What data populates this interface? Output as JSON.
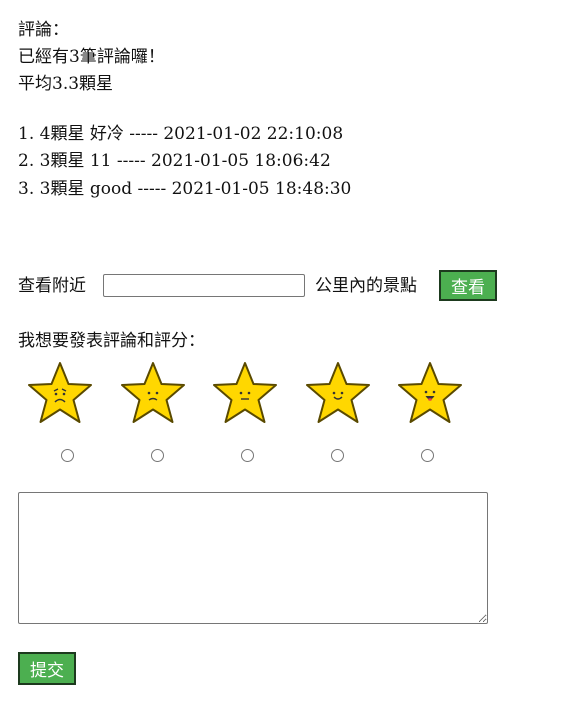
{
  "summary": {
    "heading": "評論：",
    "count_text": "已經有3筆評論囉！",
    "average_text": "平均3.3顆星"
  },
  "reviews": [
    {
      "text": "1. 4顆星 好冷 ----- 2021-01-02 22:10:08"
    },
    {
      "text": "2. 3顆星 11 ----- 2021-01-05 18:06:42"
    },
    {
      "text": "3. 3顆星 good ----- 2021-01-05 18:48:30"
    }
  ],
  "nearby": {
    "prefix": "查看附近",
    "input_value": "",
    "suffix": "公里內的景點",
    "button_label": "查看"
  },
  "rating": {
    "prompt": "我想要發表評論和評分：",
    "star_fill": "#ffd700",
    "star_stroke": "#5a4a00",
    "options": [
      {
        "icon": "sad-star-icon"
      },
      {
        "icon": "frown-star-icon"
      },
      {
        "icon": "neutral-star-icon"
      },
      {
        "icon": "smile-star-icon"
      },
      {
        "icon": "happy-star-icon"
      }
    ]
  },
  "comment": {
    "value": ""
  },
  "submit": {
    "label": "提交",
    "color": "#4caf50"
  }
}
